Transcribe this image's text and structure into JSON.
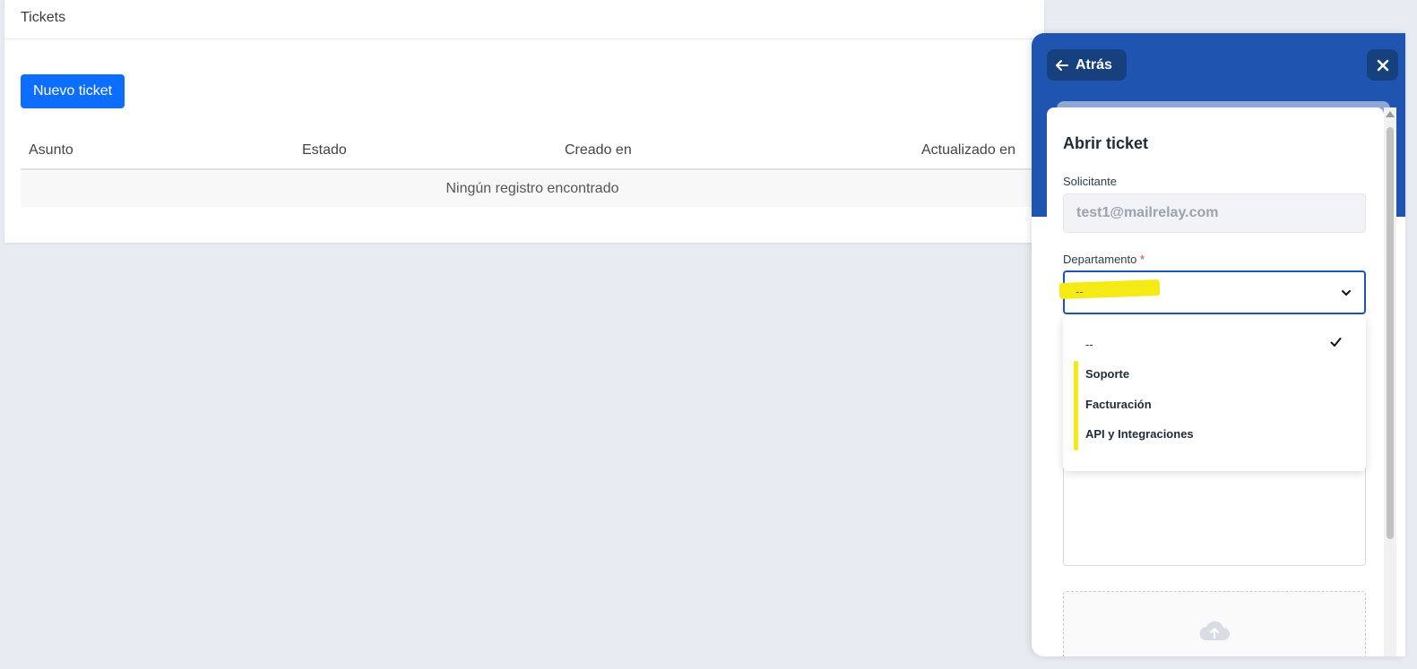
{
  "page": {
    "title": "Tickets"
  },
  "toolbar": {
    "new_ticket_label": "Nuevo ticket"
  },
  "table": {
    "columns": [
      "Asunto",
      "Estado",
      "Creado en",
      "Actualizado en"
    ],
    "empty_text": "Ningún registro encontrado"
  },
  "panel": {
    "back_label": "Atrás",
    "back_icon": "arrow-left-icon",
    "close_icon": "close-icon",
    "form_title": "Abrir ticket",
    "requester_label": "Solicitante",
    "requester_value": "test1@mailrelay.com",
    "department_label": "Departamento",
    "required_mark": "*",
    "department_value": "--",
    "department_options": [
      "--",
      "Soporte",
      "Facturación",
      "API y Integraciones"
    ],
    "selected_option_index": 0
  },
  "colors": {
    "primary": "#0d6efd",
    "panel_header": "#1f54b0",
    "highlight": "#f6ea14"
  }
}
